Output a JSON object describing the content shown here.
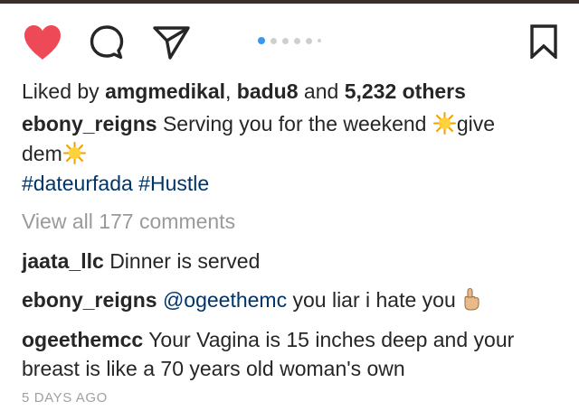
{
  "icons": {
    "like": "heart-icon",
    "comment": "comment-icon",
    "share": "paper-plane-icon",
    "save": "bookmark-icon",
    "like_color": "#ed4956",
    "accent": "#3897f0"
  },
  "carousel": {
    "count": 6,
    "active_index": 0
  },
  "likes": {
    "prefix": "Liked by",
    "user1": "amgmedikal",
    "sep": ",",
    "user2": "badu8",
    "and": "and",
    "others": "5,232 others"
  },
  "caption": {
    "username": "ebony_reigns",
    "text1": "Serving you for the weekend",
    "text2": "give",
    "text3": "dem",
    "hashtags": "#dateurfada #Hustle"
  },
  "view_all": "View all 177 comments",
  "comments": [
    {
      "username": "jaata_llc",
      "text": "Dinner is served"
    },
    {
      "username": "ebony_reigns",
      "mention": "@ogeethemc",
      "text": "you liar i hate you"
    },
    {
      "username": "ogeethemcc",
      "text": "Your Vagina is 15 inches deep and your",
      "text_line2": "breast is like a 70 years old woman's own"
    }
  ],
  "timestamp": "5 DAYS AGO"
}
